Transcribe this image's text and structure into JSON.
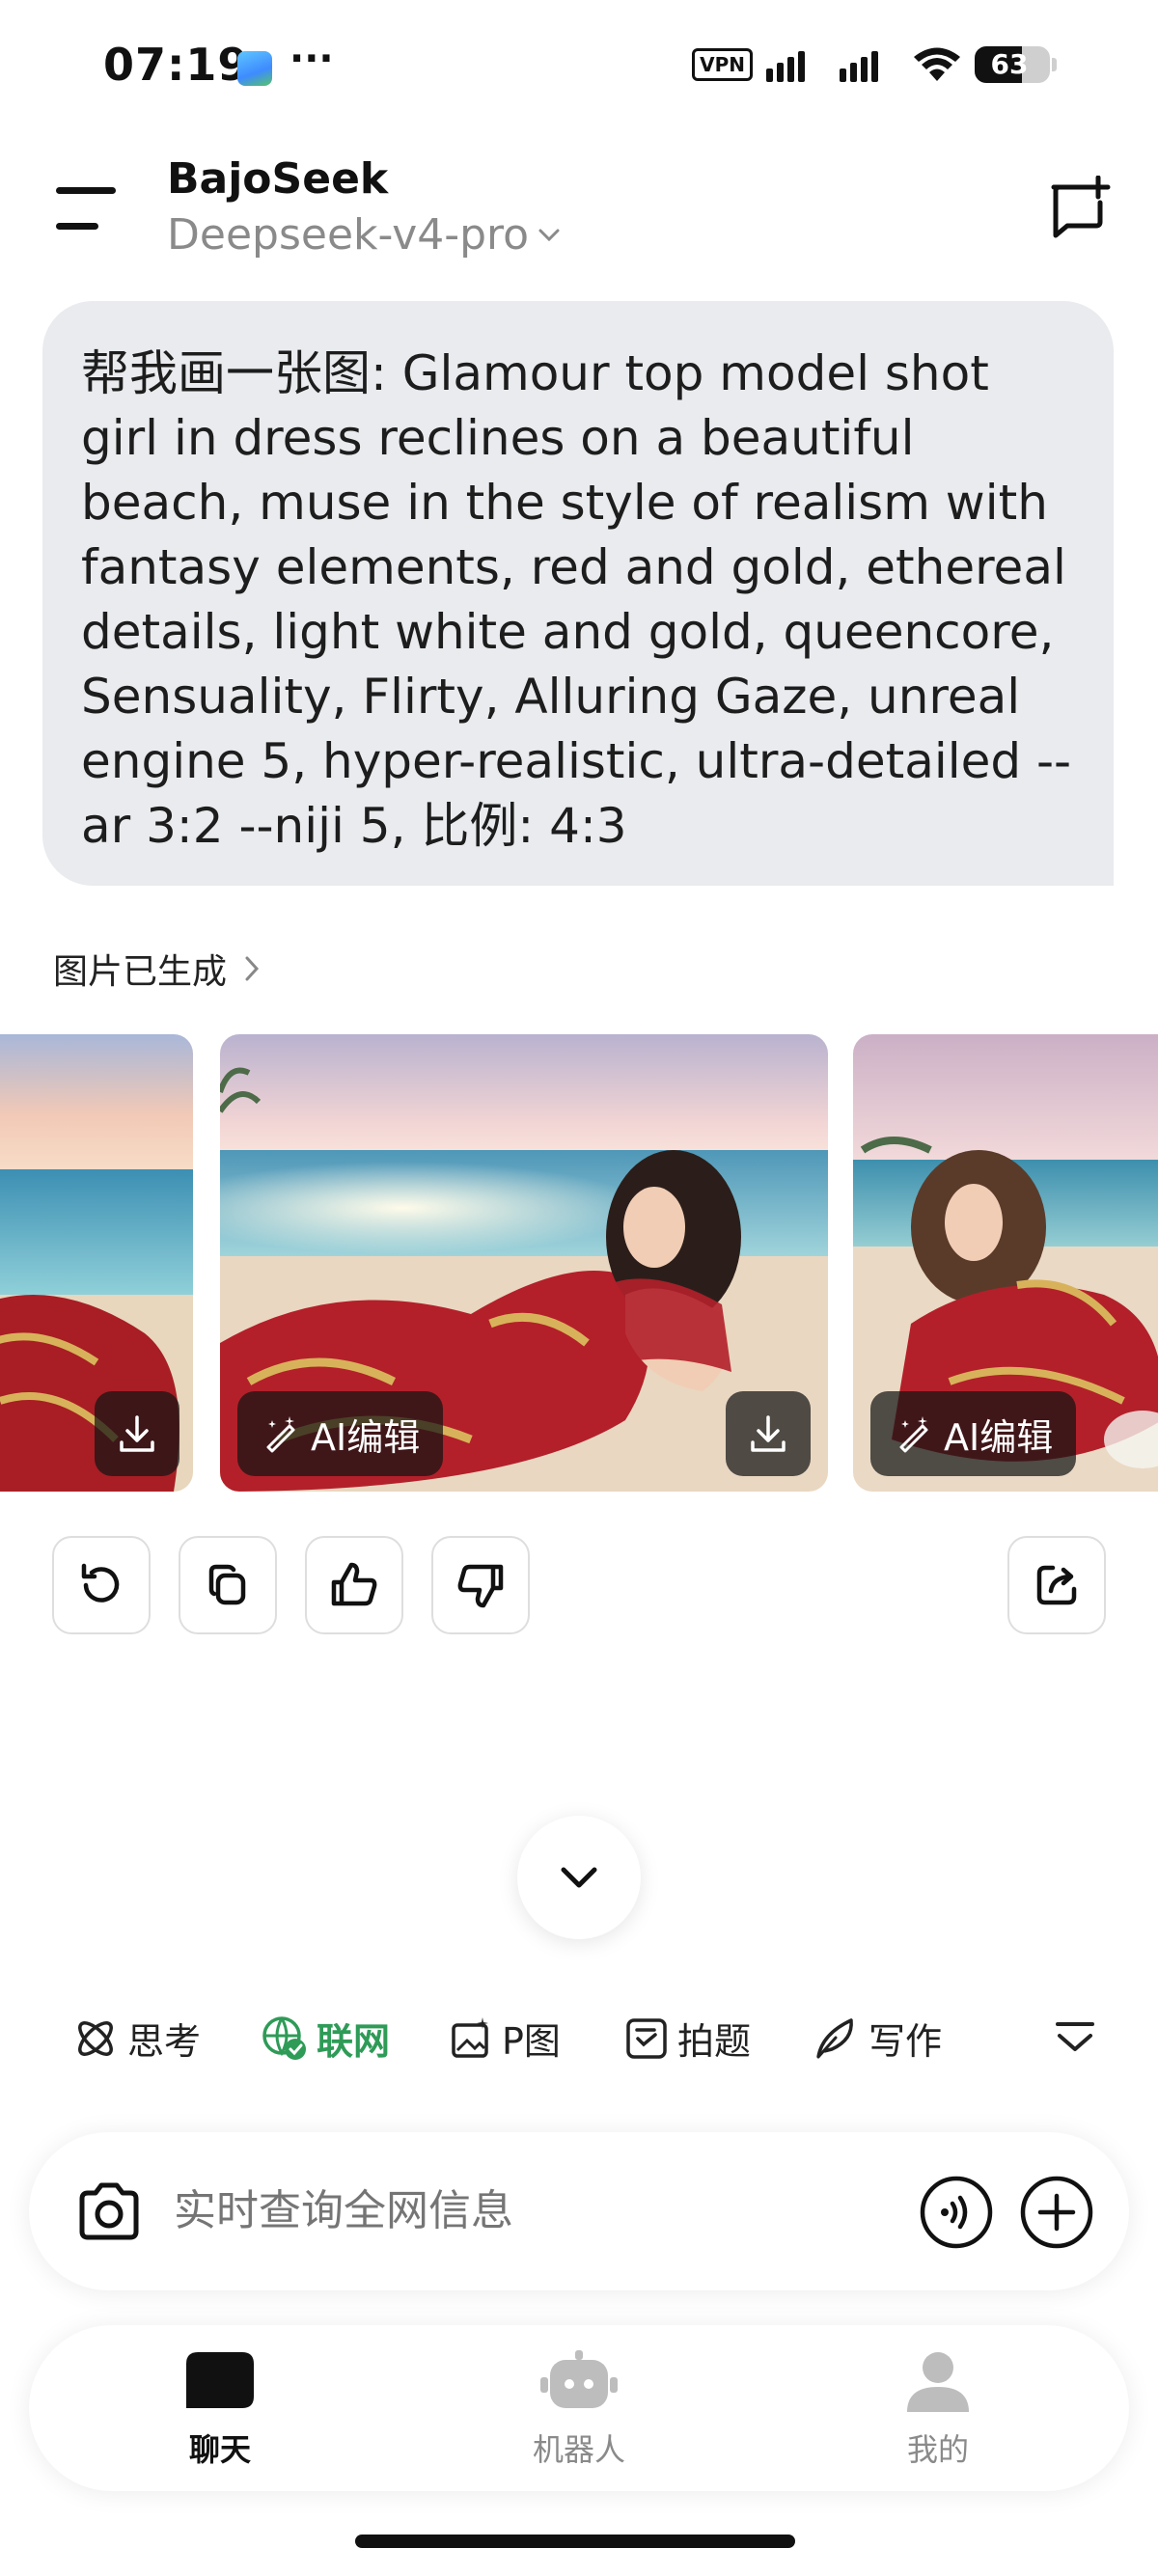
{
  "status_bar": {
    "time": "07:19",
    "more": "···",
    "vpn": "VPN",
    "battery_level": "63",
    "battery_fraction": 0.63
  },
  "header": {
    "title": "BajoSeek",
    "model": "Deepseek-v4-pro"
  },
  "message": {
    "user_text": "帮我画一张图: Glamour top model shot girl in dress reclines on a beautiful beach, muse in the style of realism with fantasy elements, red and gold, ethereal details, light white and gold, queencore, Sensuality, Flirty, Alluring Gaze, unreal engine 5, hyper-realistic, ultra-detailed --ar 3:2 --niji 5, 比例: 4:3",
    "generated_label": "图片已生成",
    "ai_edit_label": "AI编辑"
  },
  "tools": [
    {
      "label": "思考",
      "icon": "think-icon"
    },
    {
      "label": "联网",
      "icon": "web-globe-icon",
      "active": true
    },
    {
      "label": "P图",
      "icon": "image-edit-icon"
    },
    {
      "label": "拍题",
      "icon": "photo-question-icon"
    },
    {
      "label": "写作",
      "icon": "quill-icon"
    }
  ],
  "input": {
    "placeholder": "实时查询全网信息"
  },
  "nav": [
    {
      "label": "聊天",
      "icon": "chat-icon",
      "active": true
    },
    {
      "label": "机器人",
      "icon": "robot-icon"
    },
    {
      "label": "我的",
      "icon": "profile-icon"
    }
  ],
  "colors": {
    "accent_green": "#2e9b57",
    "bubble_bg": "#e9ebee",
    "dress_red": "#b3202a"
  }
}
